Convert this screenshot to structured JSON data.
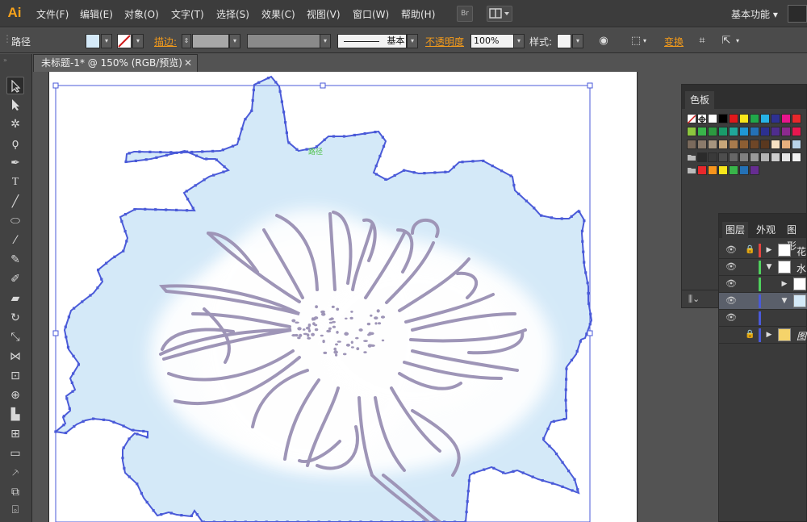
{
  "app": {
    "logo": "Ai"
  },
  "menu": [
    {
      "label": "文件(F)"
    },
    {
      "label": "编辑(E)"
    },
    {
      "label": "对象(O)"
    },
    {
      "label": "文字(T)"
    },
    {
      "label": "选择(S)"
    },
    {
      "label": "效果(C)"
    },
    {
      "label": "视图(V)"
    },
    {
      "label": "窗口(W)"
    },
    {
      "label": "帮助(H)"
    }
  ],
  "menubar_buttons": {
    "bridge": "Br",
    "arrange": "arrange-documents-icon"
  },
  "workspace": {
    "label": "基本功能"
  },
  "control": {
    "selection_type": "路径",
    "stroke_label": "描边:",
    "stroke_style": "基本",
    "opacity_label": "不透明度",
    "opacity_value": "100%",
    "style_label": "样式:",
    "transform_label": "变换"
  },
  "tools": [
    "selection-tool-icon",
    "direct-selection-tool-icon",
    "magic-wand-tool-icon",
    "lasso-tool-icon",
    "pen-tool-icon",
    "type-tool-icon",
    "line-tool-icon",
    "ellipse-tool-icon",
    "paintbrush-tool-icon",
    "pencil-tool-icon",
    "blob-brush-tool-icon",
    "eraser-tool-icon",
    "rotate-tool-icon",
    "scale-tool-icon",
    "width-tool-icon",
    "free-transform-tool-icon",
    "shape-builder-tool-icon",
    "perspective-grid-tool-icon",
    "mesh-tool-icon",
    "gradient-tool-icon",
    "eyedropper-tool-icon",
    "blend-tool-icon",
    "symbol-sprayer-tool-icon"
  ],
  "document": {
    "tab_title": "未标题-1* @ 150% (RGB/预览)"
  },
  "canvas": {
    "path_hint": "路径"
  },
  "swatches": {
    "title": "色板",
    "colors": {
      "white": "#ffffff",
      "artwork_fill": "#d4e9f8",
      "artwork_stroke": "#9e95b7",
      "path_selection": "#4a5ad8"
    }
  },
  "layers": {
    "tabs": [
      "图层",
      "外观",
      "图形"
    ],
    "rows": [
      {
        "name": "花"
      },
      {
        "name": "水"
      },
      {
        "name": ""
      },
      {
        "name": ""
      },
      {
        "name": ""
      },
      {
        "name": "图"
      }
    ]
  }
}
